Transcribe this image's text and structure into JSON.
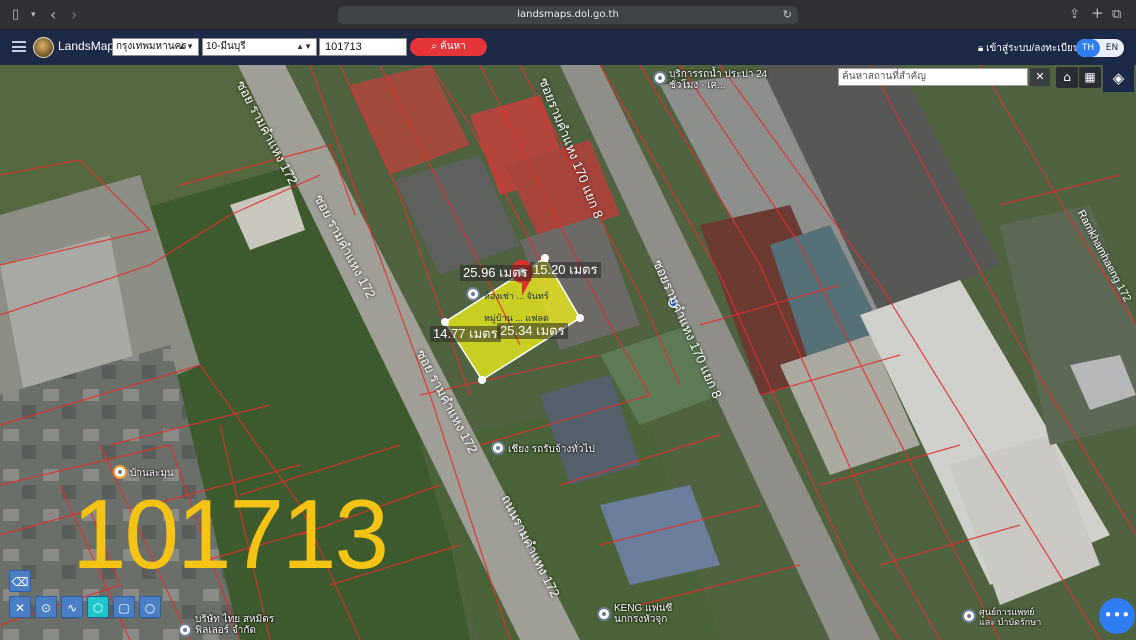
{
  "browser": {
    "url": "landsmaps.dol.go.th",
    "sidebar_icon": "sidebar-icon",
    "back_icon": "‹",
    "forward_icon": "›",
    "reload_icon": "↻",
    "share_icon": "⇪",
    "new_tab_icon": "+",
    "tabs_icon": "⧉"
  },
  "header": {
    "brand": "LandsMaps",
    "province_select": "กรุงเทพมหานคร",
    "district_select": "10-มีนบุรี",
    "parcel_search_value": "101713",
    "search_button": "ค้นหา",
    "login_link": "เข้าสู่ระบบ/ลงทะเบียน",
    "lang_th": "TH",
    "lang_en": "EN",
    "colors": {
      "header_bg": "#1d2a47",
      "search_btn": "#e5353a",
      "lang_active": "#2f7df2"
    }
  },
  "map": {
    "place_search_placeholder": "ค้นหาสถานที่สำคัญ",
    "clear_label": "✕",
    "home_icon": "⌂",
    "grid_icon": "▦",
    "layers_icon": "◈",
    "parcel_code": "101713",
    "parcel_colors": {
      "fill": "#f2f21a",
      "boundary": "#e0312c"
    },
    "measurements": [
      "25.96 เมตร",
      "15.20 เมตร",
      "14.77 เมตร",
      "25.34 เมตร"
    ],
    "roads": [
      "ซอย รามคำแหง 172",
      "ซอย รามคำแหง 172",
      "ซอย รามคำแหง 172",
      "ซอยรามคำแหง 170 แยก 8",
      "ซอยรามคำแหง 170 แยก 8",
      "ถนนรามคำแหง 172",
      "Ramkhamhaeng 172"
    ],
    "pois": [
      "บริการรถน้ำ ประปา 24 ชั่วโมง - เค...",
      "เชียง รถรับจ้างทั่วไป",
      "KENG แฟนซี นกกรงหัวจุก",
      "บ้านละมุน",
      "บริษัท ไทย สหมิตร ฟิลเลอร์ จำกัด",
      "ห้องเช่า ... จันทร์",
      "หมู่บ้าน ... แฟลต",
      "ศูนย์การแพทย์และ บำบัดรักษา"
    ]
  },
  "drawing_tools": [
    "eraser-icon",
    "measure-icon",
    "pin-icon",
    "line-icon",
    "polygon-icon",
    "rectangle-icon",
    "circle-icon"
  ],
  "chat_icon": "•••"
}
